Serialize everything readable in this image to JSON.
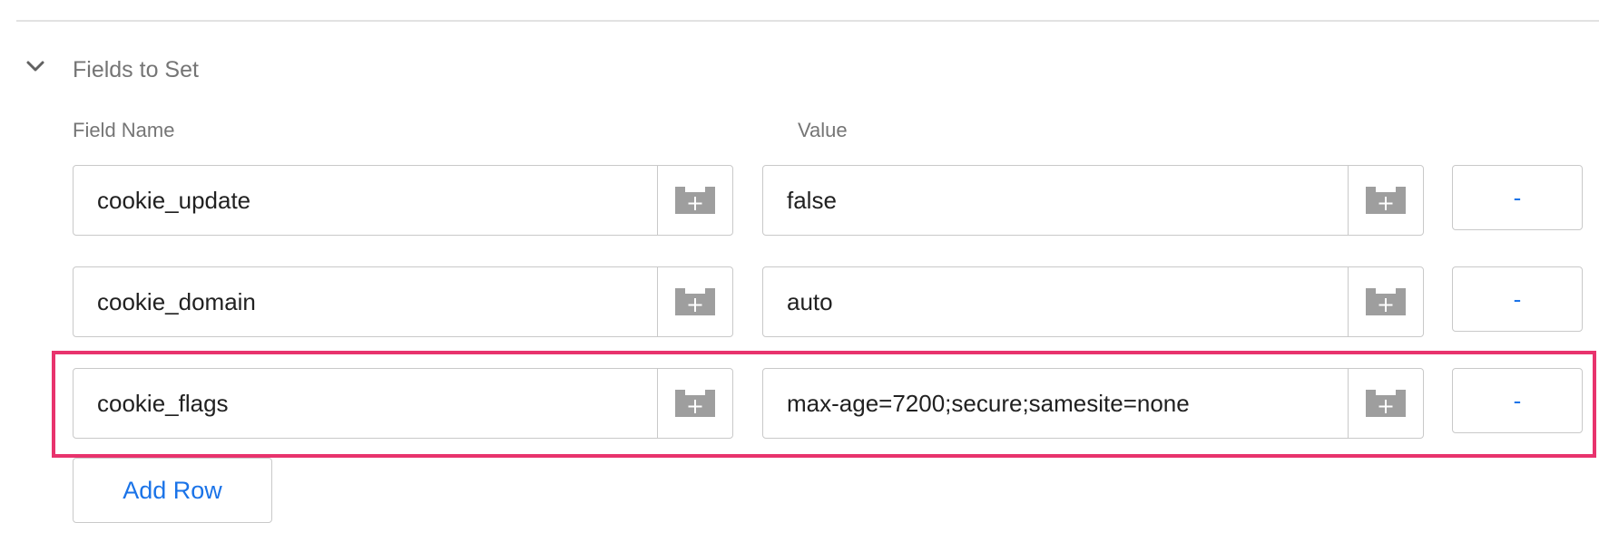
{
  "section": {
    "title": "Fields to Set",
    "expanded_icon": "chevron-down-icon"
  },
  "columns": {
    "field_name_label": "Field Name",
    "value_label": "Value"
  },
  "rows": [
    {
      "field_name": "cookie_update",
      "value": "false",
      "remove_label": "-"
    },
    {
      "field_name": "cookie_domain",
      "value": "auto",
      "remove_label": "-"
    },
    {
      "field_name": "cookie_flags",
      "value": "max-age=7200;secure;samesite=none",
      "remove_label": "-",
      "highlighted": true
    }
  ],
  "variable_icon": "variable-picker-icon",
  "add_row_label": "Add Row",
  "colors": {
    "accent": "#1a73e8",
    "highlight": "#e8336d",
    "icon_gray": "#9e9e9e",
    "border": "#c9c9c9"
  }
}
